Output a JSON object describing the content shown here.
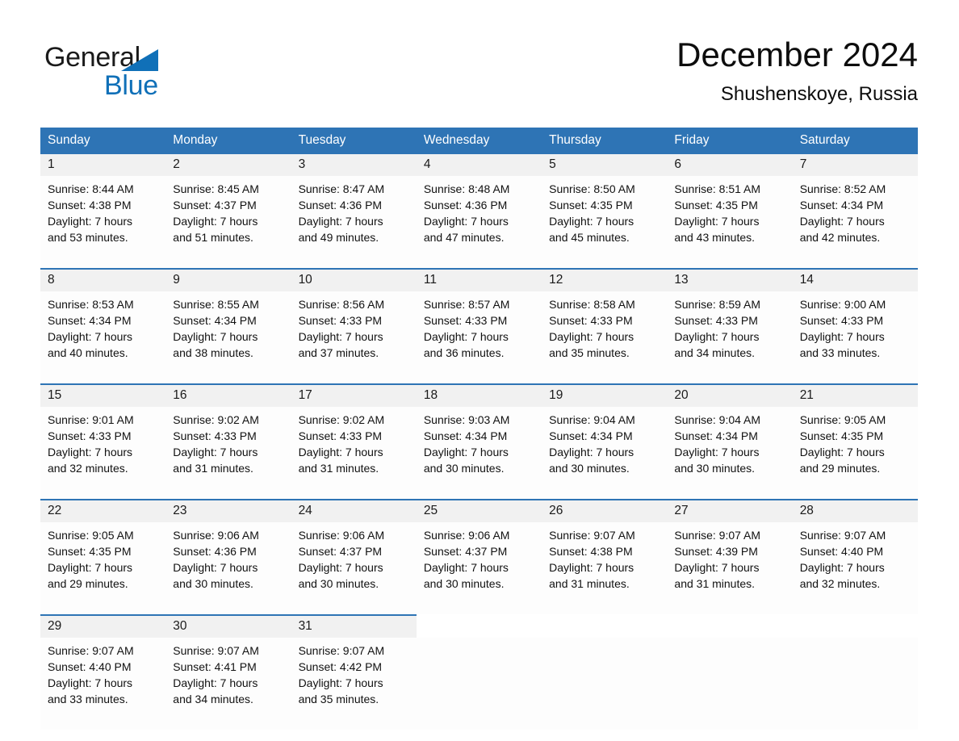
{
  "brand": {
    "name_top": "General",
    "name_bottom": "Blue",
    "triangle_color": "#1070b8",
    "text_color": "#1a1a1a"
  },
  "header": {
    "title": "December 2024",
    "subtitle": "Shushenskoye, Russia"
  },
  "theme": {
    "header_blue": "#2e74b5",
    "daynum_band": "#f1f1f1",
    "cell_background": "#fdfdfd",
    "text": "#111111"
  },
  "weekday_headers": [
    "Sunday",
    "Monday",
    "Tuesday",
    "Wednesday",
    "Thursday",
    "Friday",
    "Saturday"
  ],
  "weeks": [
    {
      "days": [
        {
          "num": "1",
          "sunrise": "Sunrise: 8:44 AM",
          "sunset": "Sunset: 4:38 PM",
          "daylight1": "Daylight: 7 hours",
          "daylight2": "and 53 minutes."
        },
        {
          "num": "2",
          "sunrise": "Sunrise: 8:45 AM",
          "sunset": "Sunset: 4:37 PM",
          "daylight1": "Daylight: 7 hours",
          "daylight2": "and 51 minutes."
        },
        {
          "num": "3",
          "sunrise": "Sunrise: 8:47 AM",
          "sunset": "Sunset: 4:36 PM",
          "daylight1": "Daylight: 7 hours",
          "daylight2": "and 49 minutes."
        },
        {
          "num": "4",
          "sunrise": "Sunrise: 8:48 AM",
          "sunset": "Sunset: 4:36 PM",
          "daylight1": "Daylight: 7 hours",
          "daylight2": "and 47 minutes."
        },
        {
          "num": "5",
          "sunrise": "Sunrise: 8:50 AM",
          "sunset": "Sunset: 4:35 PM",
          "daylight1": "Daylight: 7 hours",
          "daylight2": "and 45 minutes."
        },
        {
          "num": "6",
          "sunrise": "Sunrise: 8:51 AM",
          "sunset": "Sunset: 4:35 PM",
          "daylight1": "Daylight: 7 hours",
          "daylight2": "and 43 minutes."
        },
        {
          "num": "7",
          "sunrise": "Sunrise: 8:52 AM",
          "sunset": "Sunset: 4:34 PM",
          "daylight1": "Daylight: 7 hours",
          "daylight2": "and 42 minutes."
        }
      ]
    },
    {
      "days": [
        {
          "num": "8",
          "sunrise": "Sunrise: 8:53 AM",
          "sunset": "Sunset: 4:34 PM",
          "daylight1": "Daylight: 7 hours",
          "daylight2": "and 40 minutes."
        },
        {
          "num": "9",
          "sunrise": "Sunrise: 8:55 AM",
          "sunset": "Sunset: 4:34 PM",
          "daylight1": "Daylight: 7 hours",
          "daylight2": "and 38 minutes."
        },
        {
          "num": "10",
          "sunrise": "Sunrise: 8:56 AM",
          "sunset": "Sunset: 4:33 PM",
          "daylight1": "Daylight: 7 hours",
          "daylight2": "and 37 minutes."
        },
        {
          "num": "11",
          "sunrise": "Sunrise: 8:57 AM",
          "sunset": "Sunset: 4:33 PM",
          "daylight1": "Daylight: 7 hours",
          "daylight2": "and 36 minutes."
        },
        {
          "num": "12",
          "sunrise": "Sunrise: 8:58 AM",
          "sunset": "Sunset: 4:33 PM",
          "daylight1": "Daylight: 7 hours",
          "daylight2": "and 35 minutes."
        },
        {
          "num": "13",
          "sunrise": "Sunrise: 8:59 AM",
          "sunset": "Sunset: 4:33 PM",
          "daylight1": "Daylight: 7 hours",
          "daylight2": "and 34 minutes."
        },
        {
          "num": "14",
          "sunrise": "Sunrise: 9:00 AM",
          "sunset": "Sunset: 4:33 PM",
          "daylight1": "Daylight: 7 hours",
          "daylight2": "and 33 minutes."
        }
      ]
    },
    {
      "days": [
        {
          "num": "15",
          "sunrise": "Sunrise: 9:01 AM",
          "sunset": "Sunset: 4:33 PM",
          "daylight1": "Daylight: 7 hours",
          "daylight2": "and 32 minutes."
        },
        {
          "num": "16",
          "sunrise": "Sunrise: 9:02 AM",
          "sunset": "Sunset: 4:33 PM",
          "daylight1": "Daylight: 7 hours",
          "daylight2": "and 31 minutes."
        },
        {
          "num": "17",
          "sunrise": "Sunrise: 9:02 AM",
          "sunset": "Sunset: 4:33 PM",
          "daylight1": "Daylight: 7 hours",
          "daylight2": "and 31 minutes."
        },
        {
          "num": "18",
          "sunrise": "Sunrise: 9:03 AM",
          "sunset": "Sunset: 4:34 PM",
          "daylight1": "Daylight: 7 hours",
          "daylight2": "and 30 minutes."
        },
        {
          "num": "19",
          "sunrise": "Sunrise: 9:04 AM",
          "sunset": "Sunset: 4:34 PM",
          "daylight1": "Daylight: 7 hours",
          "daylight2": "and 30 minutes."
        },
        {
          "num": "20",
          "sunrise": "Sunrise: 9:04 AM",
          "sunset": "Sunset: 4:34 PM",
          "daylight1": "Daylight: 7 hours",
          "daylight2": "and 30 minutes."
        },
        {
          "num": "21",
          "sunrise": "Sunrise: 9:05 AM",
          "sunset": "Sunset: 4:35 PM",
          "daylight1": "Daylight: 7 hours",
          "daylight2": "and 29 minutes."
        }
      ]
    },
    {
      "days": [
        {
          "num": "22",
          "sunrise": "Sunrise: 9:05 AM",
          "sunset": "Sunset: 4:35 PM",
          "daylight1": "Daylight: 7 hours",
          "daylight2": "and 29 minutes."
        },
        {
          "num": "23",
          "sunrise": "Sunrise: 9:06 AM",
          "sunset": "Sunset: 4:36 PM",
          "daylight1": "Daylight: 7 hours",
          "daylight2": "and 30 minutes."
        },
        {
          "num": "24",
          "sunrise": "Sunrise: 9:06 AM",
          "sunset": "Sunset: 4:37 PM",
          "daylight1": "Daylight: 7 hours",
          "daylight2": "and 30 minutes."
        },
        {
          "num": "25",
          "sunrise": "Sunrise: 9:06 AM",
          "sunset": "Sunset: 4:37 PM",
          "daylight1": "Daylight: 7 hours",
          "daylight2": "and 30 minutes."
        },
        {
          "num": "26",
          "sunrise": "Sunrise: 9:07 AM",
          "sunset": "Sunset: 4:38 PM",
          "daylight1": "Daylight: 7 hours",
          "daylight2": "and 31 minutes."
        },
        {
          "num": "27",
          "sunrise": "Sunrise: 9:07 AM",
          "sunset": "Sunset: 4:39 PM",
          "daylight1": "Daylight: 7 hours",
          "daylight2": "and 31 minutes."
        },
        {
          "num": "28",
          "sunrise": "Sunrise: 9:07 AM",
          "sunset": "Sunset: 4:40 PM",
          "daylight1": "Daylight: 7 hours",
          "daylight2": "and 32 minutes."
        }
      ]
    },
    {
      "days": [
        {
          "num": "29",
          "sunrise": "Sunrise: 9:07 AM",
          "sunset": "Sunset: 4:40 PM",
          "daylight1": "Daylight: 7 hours",
          "daylight2": "and 33 minutes."
        },
        {
          "num": "30",
          "sunrise": "Sunrise: 9:07 AM",
          "sunset": "Sunset: 4:41 PM",
          "daylight1": "Daylight: 7 hours",
          "daylight2": "and 34 minutes."
        },
        {
          "num": "31",
          "sunrise": "Sunrise: 9:07 AM",
          "sunset": "Sunset: 4:42 PM",
          "daylight1": "Daylight: 7 hours",
          "daylight2": "and 35 minutes."
        },
        {
          "num": "",
          "sunrise": "",
          "sunset": "",
          "daylight1": "",
          "daylight2": ""
        },
        {
          "num": "",
          "sunrise": "",
          "sunset": "",
          "daylight1": "",
          "daylight2": ""
        },
        {
          "num": "",
          "sunrise": "",
          "sunset": "",
          "daylight1": "",
          "daylight2": ""
        },
        {
          "num": "",
          "sunrise": "",
          "sunset": "",
          "daylight1": "",
          "daylight2": ""
        }
      ]
    }
  ]
}
